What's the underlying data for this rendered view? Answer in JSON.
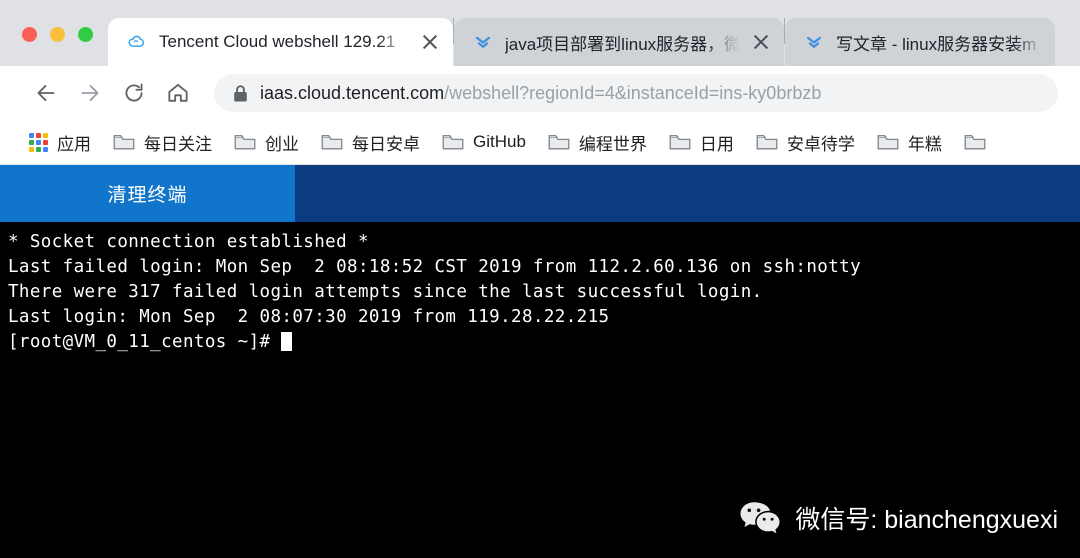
{
  "window": {
    "traffic_lights": [
      {
        "name": "close",
        "color": "#fa5e55"
      },
      {
        "name": "minimize",
        "color": "#fbbf3e"
      },
      {
        "name": "maximize",
        "color": "#2fcc44"
      }
    ]
  },
  "tabs": [
    {
      "title": "Tencent Cloud webshell 129.21",
      "favicon": "tencent-cloud-icon",
      "active": true,
      "closable": true
    },
    {
      "title": "java项目部署到linux服务器，微信",
      "favicon": "chevrons-down-icon",
      "active": false,
      "closable": true
    },
    {
      "title": "写文章 - linux服务器安装m",
      "favicon": "chevrons-down-icon",
      "active": false,
      "closable": false
    }
  ],
  "toolbar": {
    "back_icon": "back-arrow-icon",
    "forward_icon": "forward-arrow-icon",
    "reload_icon": "reload-icon",
    "home_icon": "home-icon",
    "lock_icon": "lock-icon",
    "url_host": "iaas.cloud.tencent.com",
    "url_path": "/webshell?regionId=4&instanceId=ins-ky0brbzb",
    "url_full": "iaas.cloud.tencent.com/webshell?regionId=4&instanceId=ins-ky0brbzb"
  },
  "bookmarks": [
    {
      "label": "应用",
      "icon": "apps-grid-icon"
    },
    {
      "label": "每日关注",
      "icon": "folder-icon"
    },
    {
      "label": "创业",
      "icon": "folder-icon"
    },
    {
      "label": "每日安卓",
      "icon": "folder-icon"
    },
    {
      "label": "GitHub",
      "icon": "folder-icon"
    },
    {
      "label": "编程世界",
      "icon": "folder-icon"
    },
    {
      "label": "日用",
      "icon": "folder-icon"
    },
    {
      "label": "安卓待学",
      "icon": "folder-icon"
    },
    {
      "label": "年糕",
      "icon": "folder-icon"
    },
    {
      "label": "",
      "icon": "folder-icon"
    }
  ],
  "webshell_bar": {
    "clear_terminal_label": "清理终端",
    "left_color": "#1275cc",
    "right_color": "#0b3c80"
  },
  "terminal": {
    "background": "#000000",
    "foreground": "#ffffff",
    "lines": [
      "* Socket connection established *",
      "Last failed login: Mon Sep  2 08:18:52 CST 2019 from 112.2.60.136 on ssh:notty",
      "There were 317 failed login attempts since the last successful login.",
      "Last login: Mon Sep  2 08:07:30 2019 from 119.28.22.215"
    ],
    "prompt": "[root@VM_0_11_centos ~]#",
    "cursor_visible": true
  },
  "watermark": {
    "icon": "wechat-icon",
    "text": "微信号: bianchengxuexi"
  }
}
